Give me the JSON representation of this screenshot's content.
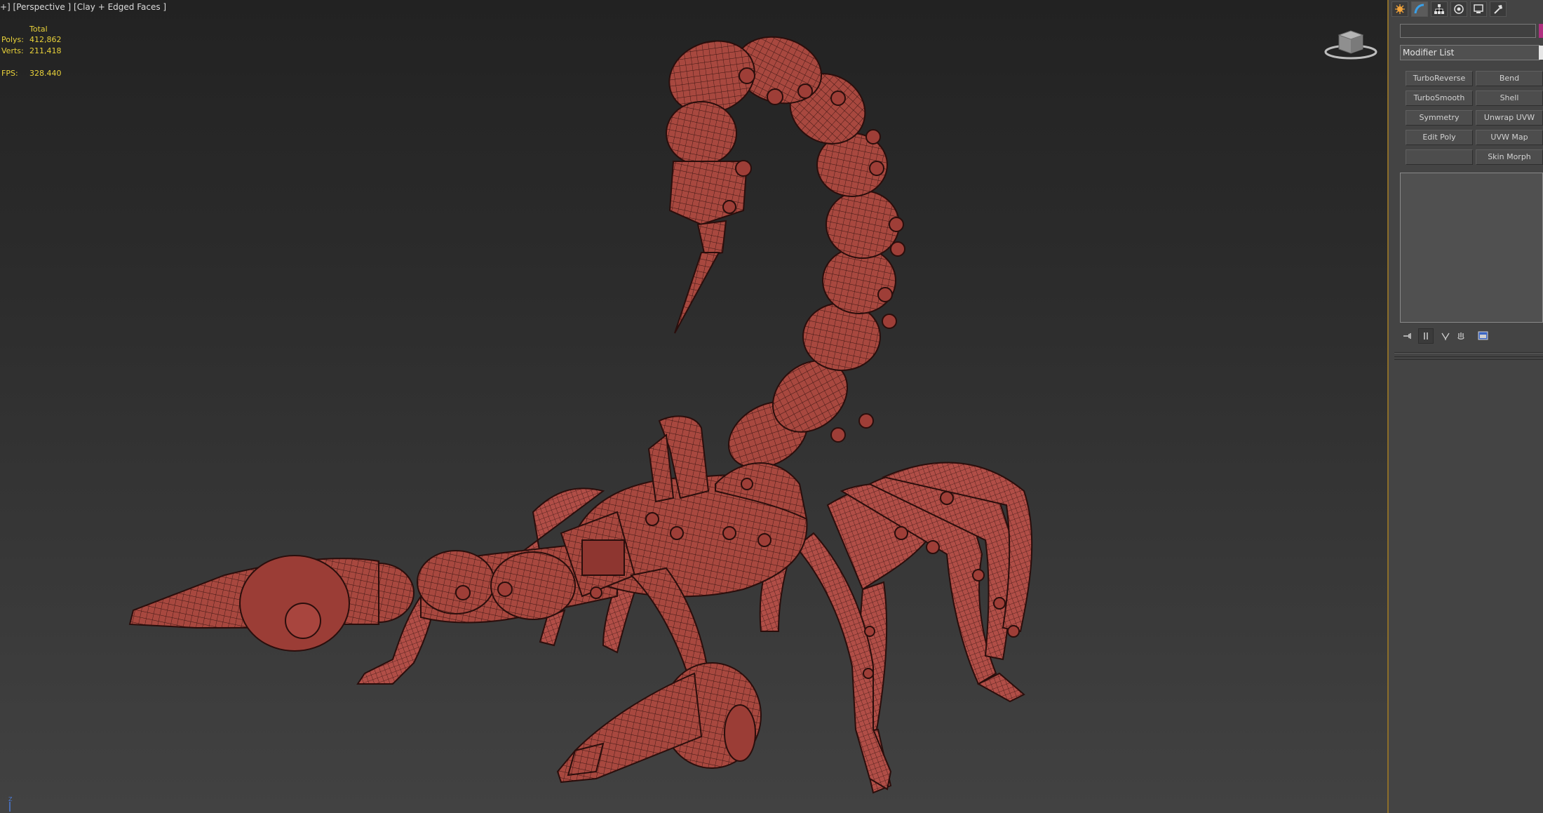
{
  "viewport": {
    "label": "+] [Perspective ] [Clay + Edged Faces ]",
    "stats": {
      "total_label": "Total",
      "polys_label": "Polys:",
      "polys_value": "412,862",
      "verts_label": "Verts:",
      "verts_value": "211,418",
      "fps_label": "FPS:",
      "fps_value": "328.440"
    },
    "mesh_color": "#b14e47",
    "wire_color": "#2a0e0c",
    "viewcube_icon": "viewcube-icon",
    "axis_label": "Z"
  },
  "command_panel": {
    "tabs": [
      {
        "icon": "create-icon"
      },
      {
        "icon": "modify-icon"
      },
      {
        "icon": "hierarchy-icon"
      },
      {
        "icon": "motion-icon"
      },
      {
        "icon": "display-icon"
      },
      {
        "icon": "utilities-icon"
      }
    ],
    "name_field_value": "",
    "modifier_list_label": "Modifier List",
    "modifier_buttons": [
      "TurboReverse",
      "Bend",
      "TurboSmooth",
      "Shell",
      "Symmetry",
      "Unwrap UVW",
      "Edit Poly",
      "UVW Map",
      "",
      "Skin Morph"
    ],
    "stack_tools": [
      {
        "icon": "pin-stack-icon"
      },
      {
        "icon": "show-end-result-icon"
      },
      {
        "icon": "make-unique-icon"
      },
      {
        "icon": "remove-modifier-icon"
      },
      {
        "icon": "configure-modifier-sets-icon"
      }
    ],
    "accent_color": "#8c6e2a"
  }
}
